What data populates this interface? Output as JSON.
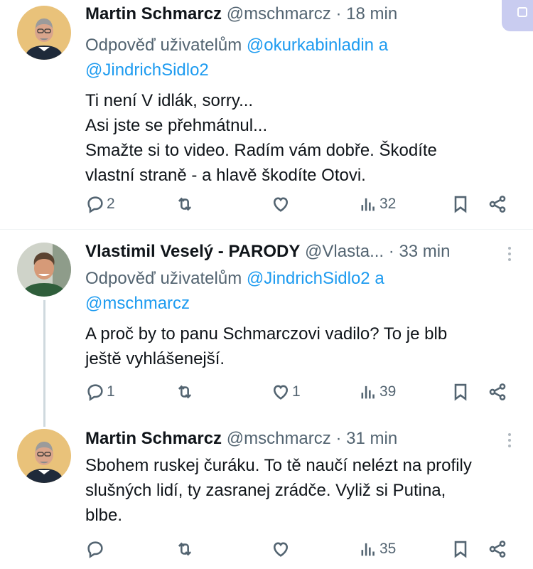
{
  "tweets": [
    {
      "name": "Martin Schmarcz",
      "handle": "@mschmarcz",
      "dot": "·",
      "time": "18 min",
      "reply_prefix": "Odpověď uživatelům",
      "reply_mention_1": "@okurkabinladin",
      "reply_and": "a",
      "reply_mention_2": "@JindrichSidlo2",
      "text_lines": [
        "Ti není V idlák, sorry...",
        "Asi jste se přehmátnul...",
        "Smažte si to video. Radím vám dobře. Škodíte",
        "vlastní straně - a hlavě škodíte Otovi."
      ],
      "replies": "2",
      "retweets": "",
      "likes": "",
      "views": "32"
    },
    {
      "name": "Vlastimil Veselý - PARODY",
      "handle": "@Vlasta...",
      "dot": "·",
      "time": "33 min",
      "reply_prefix": "Odpověď uživatelům",
      "reply_mention_1": "@JindrichSidlo2",
      "reply_and": "a",
      "reply_mention_2": "@mschmarcz",
      "text_lines": [
        "A proč by to panu Schmarczovi vadilo? To je blb",
        "ještě vyhlášenejší."
      ],
      "replies": "1",
      "retweets": "",
      "likes": "1",
      "views": "39"
    },
    {
      "name": "Martin Schmarcz",
      "handle": "@mschmarcz",
      "dot": "·",
      "time": "31 min",
      "text_lines": [
        "Sbohem ruskej čuráku. To tě naučí nelézt na profily",
        "slušných lidí, ty zasranej zrádče. Vyliž si Putina,",
        "blbe."
      ],
      "replies": "",
      "retweets": "",
      "likes": "",
      "views": "35"
    }
  ],
  "icons": {
    "reply": "reply-icon",
    "retweet": "retweet-icon",
    "like": "heart-icon",
    "views": "views-icon",
    "bookmark": "bookmark-icon",
    "share": "share-icon",
    "more": "more-icon"
  },
  "colors": {
    "name": "#0f1419",
    "secondary": "#536471",
    "mention": "#1d9bf0",
    "divider": "#eff3f4",
    "thread_line": "#cfd9de"
  }
}
